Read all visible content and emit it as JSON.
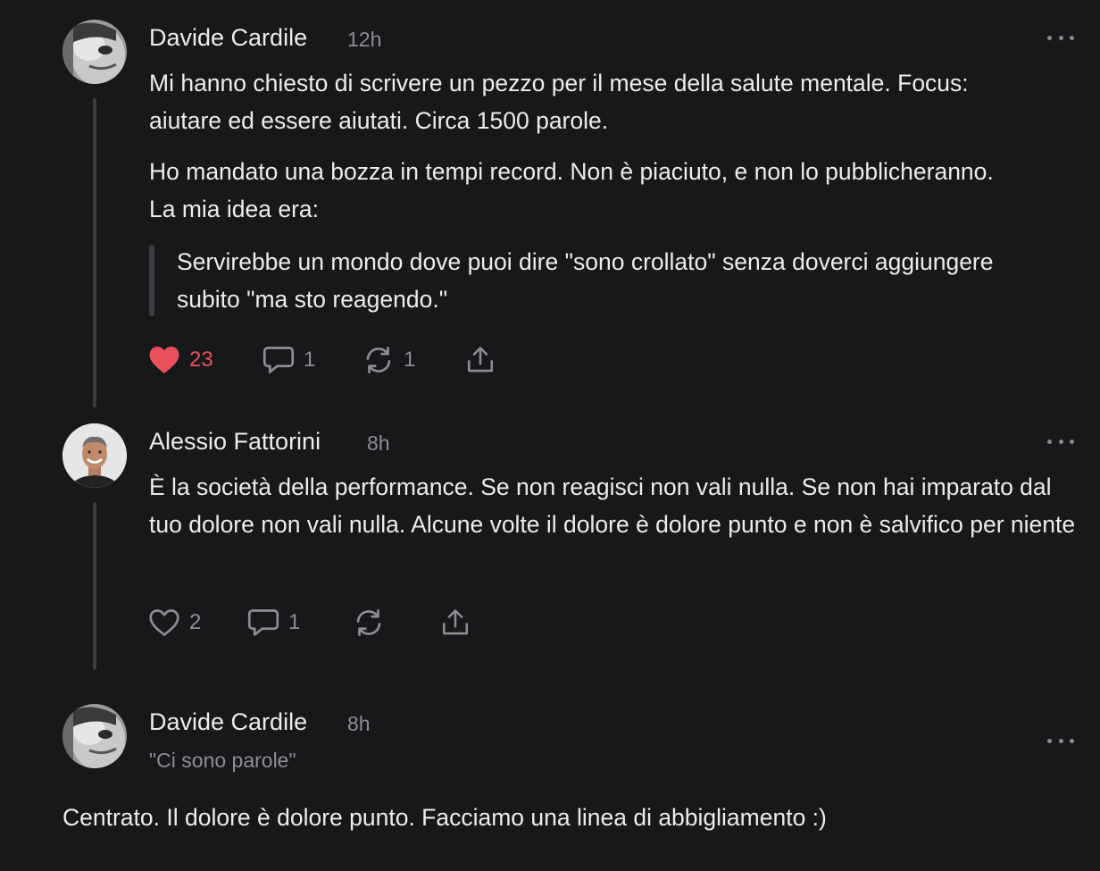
{
  "posts": [
    {
      "author": "Davide Cardile",
      "time": "12h",
      "paragraphs": [
        "Mi hanno chiesto di scrivere un pezzo per il mese della salute mentale. Focus: aiutare ed essere aiutati. Circa 1500 parole.",
        "Ho mandato una bozza in tempi record. Non è piaciuto, e non lo pubblicheranno. La mia idea era:"
      ],
      "quote": "Servirebbe un mondo dove puoi dire \"sono crollato\" senza doverci aggiungere subito \"ma sto reagendo.\"",
      "likes": "23",
      "comments": "1",
      "restacks": "1",
      "liked": true,
      "avatar_icon": "grayscale-face-avatar"
    },
    {
      "author": "Alessio Fattorini",
      "time": "8h",
      "paragraphs": [
        "È la società della performance. Se non reagisci non vali nulla. Se non hai imparato dal tuo dolore non vali nulla. Alcune volte il dolore è dolore punto e non è salvifico per niente"
      ],
      "likes": "2",
      "comments": "1",
      "restacks": "",
      "liked": false,
      "avatar_icon": "smiling-man-avatar"
    },
    {
      "author": "Davide Cardile",
      "time": "8h",
      "subtitle": "\"Ci sono parole\"",
      "reply": "Centrato. Il dolore è dolore punto. Facciamo una linea di abbigliamento :)",
      "avatar_icon": "grayscale-face-avatar"
    }
  ],
  "icons": {
    "like": "heart-icon",
    "comment": "comment-bubble-icon",
    "restack": "restack-arrows-icon",
    "share": "share-upload-icon",
    "more": "more-dots-icon"
  },
  "colors": {
    "background": "#17181a",
    "liked": "#e8505b",
    "muted": "#8d8e93",
    "text": "#ececee"
  }
}
